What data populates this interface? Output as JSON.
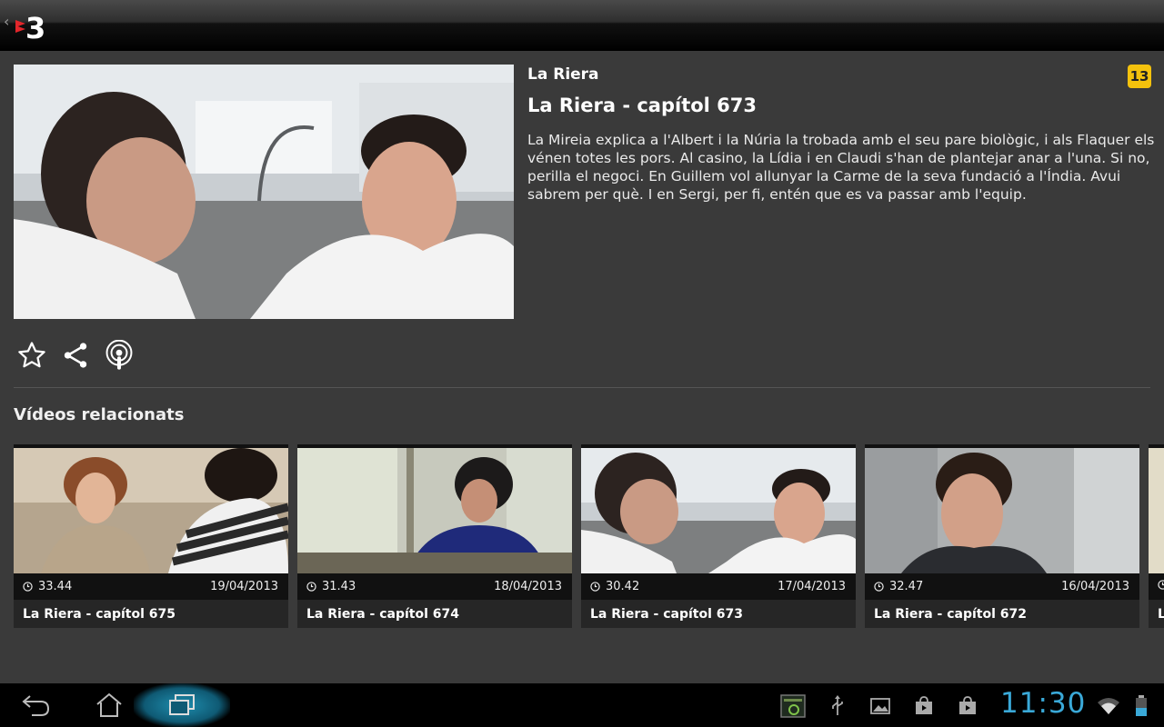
{
  "app": {
    "logo_text": "3"
  },
  "episode": {
    "series": "La Riera",
    "title": "La Riera - capítol 673",
    "age_rating": "13",
    "description": "La Mireia explica a l'Albert i la Núria la trobada amb el seu pare biològic, i als Flaquer els vénen totes les pors. Al casino, la Lídia i en Claudi s'han de plantejar anar a l'una. Si no, perilla el negoci. En Guillem vol allunyar la Carme de la seva fundació a l'Índia. Avui sabrem per què. I en Sergi, per fi, entén que es va passar amb l'equip."
  },
  "actions": [
    {
      "icon": "star-icon"
    },
    {
      "icon": "share-icon"
    },
    {
      "icon": "podcast-icon"
    }
  ],
  "related": {
    "heading": "Vídeos relacionats",
    "items": [
      {
        "title": "La Riera - capítol 675",
        "duration": "33.44",
        "date": "19/04/2013"
      },
      {
        "title": "La Riera - capítol 674",
        "duration": "31.43",
        "date": "18/04/2013"
      },
      {
        "title": "La Riera - capítol 673",
        "duration": "30.42",
        "date": "17/04/2013"
      },
      {
        "title": "La Riera - capítol 672",
        "duration": "32.47",
        "date": "16/04/2013"
      },
      {
        "title": "L",
        "duration": "",
        "date": ""
      }
    ]
  },
  "system": {
    "clock": "11:30",
    "accent_color": "#3aa9d8"
  }
}
